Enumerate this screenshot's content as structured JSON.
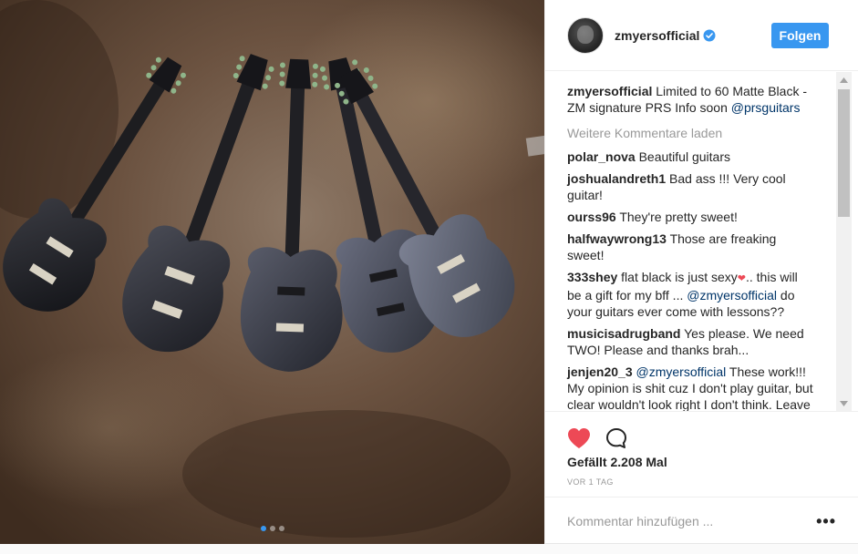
{
  "post": {
    "photo_alt": "Five matte black PRS guitars on a concrete floor",
    "carousel_count": 3,
    "carousel_active": 1
  },
  "header": {
    "username": "zmyersofficial",
    "verified": true,
    "follow_label": "Folgen"
  },
  "caption": {
    "author": "zmyersofficial",
    "text": "Limited to 60 Matte Black - ZM signature PRS Info soon",
    "mention": "@prsguitars"
  },
  "load_more_label": "Weitere Kommentare laden",
  "comments": [
    {
      "author": "polar_nova",
      "text": "Beautiful guitars"
    },
    {
      "author": "joshualandreth1",
      "text": "Bad ass !!! Very cool guitar!"
    },
    {
      "author": "ourss96",
      "text": "They're pretty sweet!"
    },
    {
      "author": "halfwaywrong13",
      "text": "Those are freaking sweet!"
    },
    {
      "author": "333shey",
      "text_a": "flat black is just sexy",
      "emoji": "❤",
      "text_b": ".. this will be a gift for my bff ... ",
      "mention": "@zmyersofficial",
      "text_c": " do your guitars ever come with lessons??"
    },
    {
      "author": "musicisadrugband",
      "text": "Yes please. We need TWO! Please and thanks brah..."
    },
    {
      "author": "jenjen20_3",
      "mention": "@zmyersofficial",
      "text": " These work!!! My opinion is shit cuz I don't play guitar, but clear wouldn't look right I don't think. Leave em!"
    }
  ],
  "actions": {
    "like_icon": "heart-filled-icon",
    "comment_icon": "comment-bubble-icon",
    "likes_label": "Gefällt 2.208 Mal",
    "time_label": "VOR 1 TAG"
  },
  "add_comment": {
    "placeholder": "Kommentar hinzufügen ...",
    "more_label": "•••"
  },
  "colors": {
    "accent": "#3897f0",
    "like_red": "#ed4956",
    "mention": "#003569",
    "muted": "#999999"
  }
}
